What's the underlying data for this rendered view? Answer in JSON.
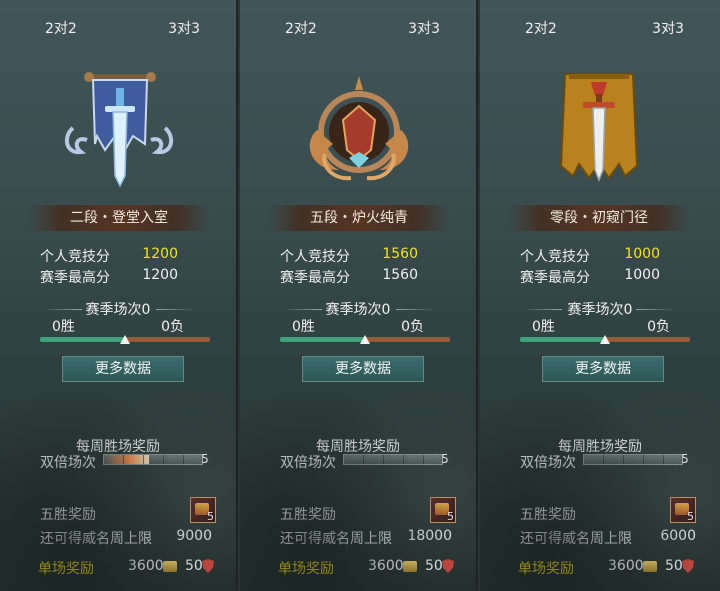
{
  "panels": [
    {
      "tabs": [
        "2对2",
        "3对3"
      ],
      "rank_title": "二段・登堂入室",
      "emblem": "blue-banner-sword-icon",
      "stats": [
        {
          "label": "个人竞技分",
          "value": "1200",
          "highlight": true
        },
        {
          "label": "赛季最高分",
          "value": "1200",
          "highlight": false
        }
      ],
      "season_title": "赛季场次0",
      "wins": "0胜",
      "losses": "0负",
      "win_ratio": 0.5,
      "more_button": "更多数据",
      "weekly_title": "每周胜场奖励",
      "double_label": "双倍场次",
      "double_progress": 0.45,
      "double_total": "5",
      "five_win_label": "五胜奖励",
      "chest_count": "5",
      "cap_label": "还可得威名周上限",
      "cap_value": "9000",
      "single_label": "单场奖励",
      "single_gold": "3600",
      "single_honor": "50"
    },
    {
      "tabs": [
        "2对2",
        "3对3"
      ],
      "rank_title": "五段・炉火纯青",
      "emblem": "bronze-winged-crest-icon",
      "stats": [
        {
          "label": "个人竞技分",
          "value": "1560",
          "highlight": true
        },
        {
          "label": "赛季最高分",
          "value": "1560",
          "highlight": false
        }
      ],
      "season_title": "赛季场次0",
      "wins": "0胜",
      "losses": "0负",
      "win_ratio": 0.5,
      "more_button": "更多数据",
      "weekly_title": "每周胜场奖励",
      "double_label": "双倍场次",
      "double_progress": 0,
      "double_total": "5",
      "five_win_label": "五胜奖励",
      "chest_count": "5",
      "cap_label": "还可得威名周上限",
      "cap_value": "18000",
      "single_label": "单场奖励",
      "single_gold": "3600",
      "single_honor": "50"
    },
    {
      "tabs": [
        "2对2",
        "3对3"
      ],
      "rank_title": "零段・初窥门径",
      "emblem": "gold-tattered-banner-sword-icon",
      "stats": [
        {
          "label": "个人竞技分",
          "value": "1000",
          "highlight": true
        },
        {
          "label": "赛季最高分",
          "value": "1000",
          "highlight": false
        }
      ],
      "season_title": "赛季场次0",
      "wins": "0胜",
      "losses": "0负",
      "win_ratio": 0.5,
      "more_button": "更多数据",
      "weekly_title": "每周胜场奖励",
      "double_label": "双倍场次",
      "double_progress": 0,
      "double_total": "5",
      "five_win_label": "五胜奖励",
      "chest_count": "5",
      "cap_label": "还可得威名周上限",
      "cap_value": "6000",
      "single_label": "单场奖励",
      "single_gold": "3600",
      "single_honor": "50"
    }
  ],
  "colors": {
    "highlight_score": "#f7e21d",
    "single_reward_label": "#f7d51d",
    "win_bar": "#3fa07a",
    "loss_bar": "#9a5b3a",
    "button": "#2c5656"
  }
}
